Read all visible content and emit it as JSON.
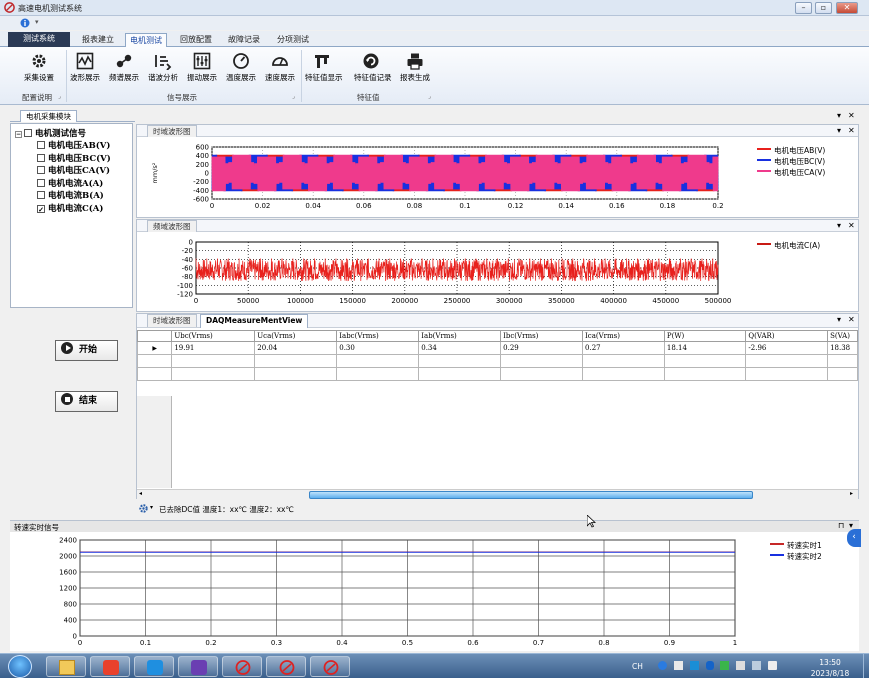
{
  "window": {
    "title": "高速电机测试系统",
    "controls": [
      "–",
      "▫",
      "✕"
    ]
  },
  "menu_tabs": [
    {
      "label": "测试系统"
    },
    {
      "label": "报表建立"
    },
    {
      "label": "电机测试"
    },
    {
      "label": "回放配置"
    },
    {
      "label": "故障记录"
    },
    {
      "label": "分项测试"
    }
  ],
  "ribbon": {
    "groups": [
      {
        "label": "配置说明"
      },
      {
        "label": "信号展示"
      },
      {
        "label": "特征值"
      }
    ],
    "buttons": [
      {
        "label": "采集设置",
        "icon": "gear-icon"
      },
      {
        "label": "波形展示",
        "icon": "waveform-icon"
      },
      {
        "label": "频谱展示",
        "icon": "spectrum-icon"
      },
      {
        "label": "谐波分析",
        "icon": "harmonic-icon"
      },
      {
        "label": "振动展示",
        "icon": "vibration-icon"
      },
      {
        "label": "温度展示",
        "icon": "temperature-icon"
      },
      {
        "label": "速度展示",
        "icon": "speed-gauge-icon"
      },
      {
        "label": "特征值显示",
        "icon": "feature-display-icon"
      },
      {
        "label": "特征值记录",
        "icon": "refresh-record-icon"
      },
      {
        "label": "报表生成",
        "icon": "printer-icon"
      }
    ]
  },
  "left_panel": {
    "tab": "电机采集模块",
    "tree_root": "电机测试信号",
    "signals": [
      {
        "label": "电机电压AB(V)",
        "checked": false
      },
      {
        "label": "电机电压BC(V)",
        "checked": false
      },
      {
        "label": "电机电压CA(V)",
        "checked": false
      },
      {
        "label": "电机电流A(A)",
        "checked": false
      },
      {
        "label": "电机电流B(A)",
        "checked": false
      },
      {
        "label": "电机电流C(A)",
        "checked": true
      }
    ],
    "start_button": "开始",
    "stop_button": "结束"
  },
  "colors": {
    "red": "#e8201c",
    "blue": "#1830e0",
    "magenta": "#ef3a8c",
    "accent": "#2b3a55"
  },
  "time_panel": {
    "tab": "时域波形图",
    "ylabel": "mm/s²",
    "legend": [
      "电机电压AB(V)",
      "电机电压BC(V)",
      "电机电压CA(V)"
    ]
  },
  "freq_panel": {
    "tab": "频域波形图",
    "legend": [
      "电机电流C(A)"
    ]
  },
  "measure_panel": {
    "tabs": [
      "时域波形图",
      "DAQMeasureMentView"
    ],
    "columns": [
      "Ubc(Vrms)",
      "Uca(Vrms)",
      "Iabc(Vrms)",
      "Iab(Vrms)",
      "Ibc(Vrms)",
      "Ica(Vrms)",
      "P(W)",
      "Q(VAR)",
      "S(VA)"
    ],
    "row": [
      "19.91",
      "20.04",
      "0.30",
      "0.34",
      "0.29",
      "0.27",
      "18.14",
      "-2.96",
      "18.38"
    ]
  },
  "status": {
    "text": "已去除DC值  温度1：xx℃  温度2：xx℃"
  },
  "speed_panel": {
    "title": "转速实时信号",
    "legend": [
      "转速实时1",
      "转速实时2"
    ]
  },
  "chart_data": [
    {
      "type": "line",
      "title": "",
      "ylabel": "mm/s²",
      "xlim": [
        0,
        0.2
      ],
      "ylim": [
        -600,
        600
      ],
      "x_ticks": [
        0,
        0.02,
        0.04,
        0.06,
        0.08,
        0.1,
        0.12,
        0.14,
        0.16,
        0.18,
        0.2
      ],
      "y_ticks": [
        600,
        400,
        200,
        0,
        -200,
        -400,
        -600
      ],
      "series": [
        {
          "name": "电机电压AB(V)",
          "amplitude": 420,
          "cycles": 10,
          "phase_deg": 0
        },
        {
          "name": "电机电压BC(V)",
          "amplitude": 420,
          "cycles": 10,
          "phase_deg": 120
        },
        {
          "name": "电机电压CA(V)",
          "amplitude": 420,
          "cycles": 10,
          "phase_deg": 240
        }
      ]
    },
    {
      "type": "line",
      "title": "",
      "xlim": [
        0,
        500000
      ],
      "ylim": [
        -120,
        0
      ],
      "x_ticks": [
        0,
        50000,
        100000,
        150000,
        200000,
        250000,
        300000,
        350000,
        400000,
        450000,
        500000
      ],
      "y_ticks": [
        0,
        -20,
        -40,
        -60,
        -80,
        -100,
        -120
      ],
      "series": [
        {
          "name": "电机电流C(A)",
          "noise_floor": -65,
          "noise_range": [
            -90,
            -40
          ],
          "peak_count": 48,
          "peak_level": -38
        }
      ]
    },
    {
      "type": "line",
      "title": "",
      "xlim": [
        0,
        1
      ],
      "ylim": [
        0,
        2400
      ],
      "x_ticks": [
        0,
        0.1,
        0.2,
        0.3,
        0.4,
        0.5,
        0.6,
        0.7,
        0.8,
        0.9,
        1
      ],
      "y_ticks": [
        2400,
        2000,
        1600,
        1200,
        800,
        400,
        0
      ],
      "series": [
        {
          "name": "转速实时1",
          "values_constant": 2100
        },
        {
          "name": "转速实时2",
          "values_constant": 2095
        }
      ]
    }
  ],
  "taskbar": {
    "time": "13:50",
    "date": "2023/8/18",
    "lang": "CH"
  }
}
